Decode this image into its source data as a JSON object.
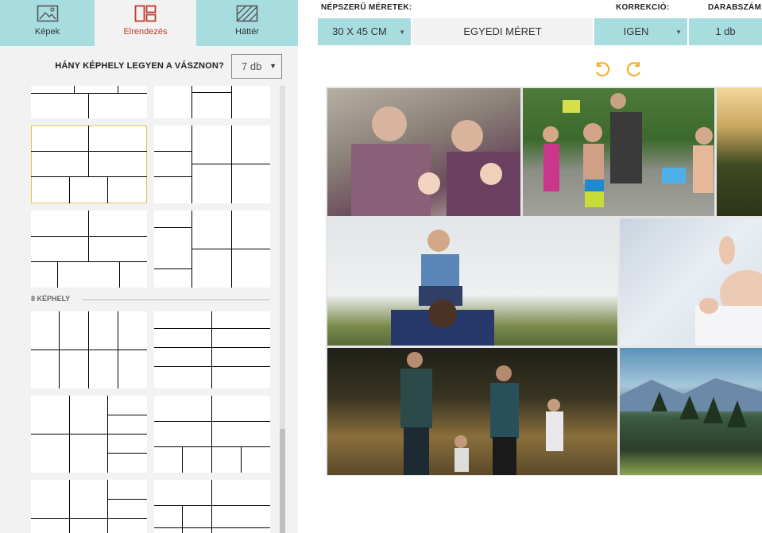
{
  "tabs": [
    {
      "label": "Képek",
      "icon": "image-icon"
    },
    {
      "label": "Elrendezés",
      "icon": "layout-icon"
    },
    {
      "label": "Háttér",
      "icon": "background-icon"
    }
  ],
  "question": {
    "text": "HÁNY KÉPHELY LEGYEN A VÁSZNON?",
    "value": "7 db"
  },
  "section8": "8 KÉPHELY",
  "headers": {
    "popular": "NÉPSZERŰ MÉRETEK:",
    "correction": "KORREKCIÓ:",
    "quantity": "DARABSZÁM:"
  },
  "buttons": {
    "size": "30 X 45 CM",
    "custom": "EGYEDI MÉRET",
    "correction": "IGEN",
    "quantity": "1 db"
  },
  "colors": {
    "teal": "#a8dde0",
    "accent_red": "#c0392b",
    "undo_orange": "#f0b030",
    "selected_border": "#e8c25a"
  }
}
